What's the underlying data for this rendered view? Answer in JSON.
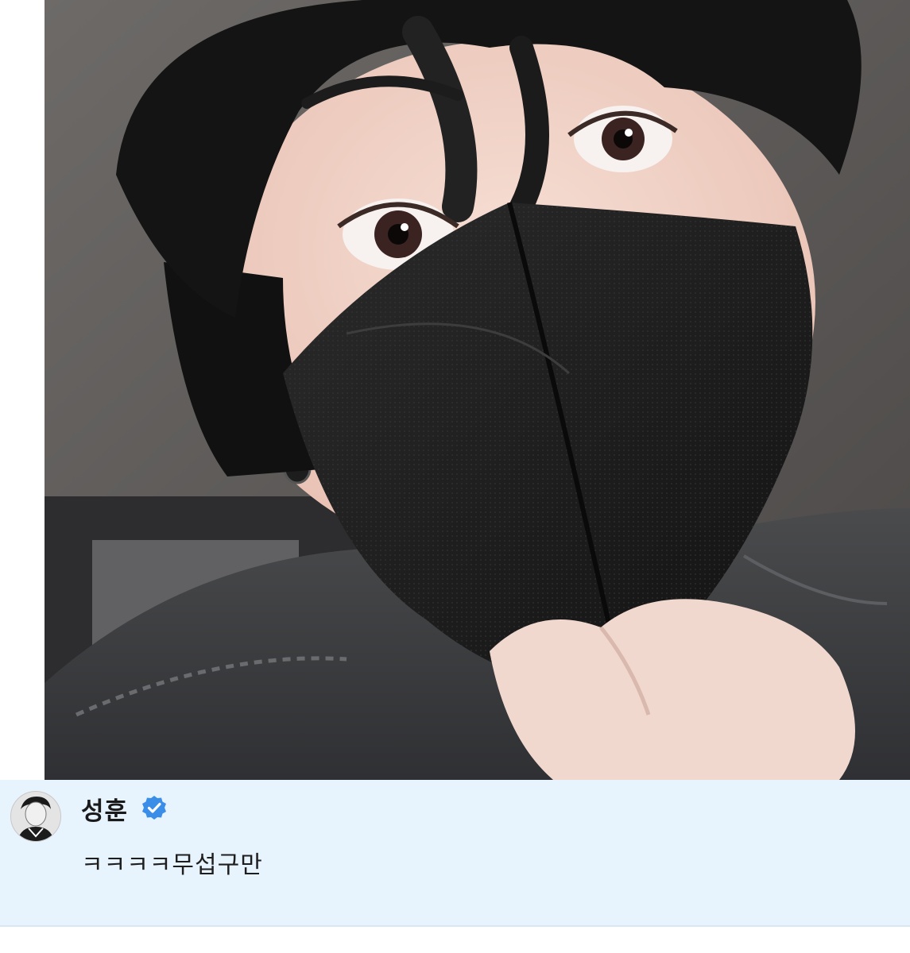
{
  "comment": {
    "username": "성훈",
    "verified": true,
    "text": "ㅋㅋㅋㅋ무섭구만"
  },
  "photo": {
    "subject": "selfie-person-black-mask"
  },
  "icons": {
    "verified": "verified-badge-icon",
    "avatar": "avatar"
  },
  "colors": {
    "card_background": "#e7f3fd",
    "verified_blue": "#3b8ee8",
    "text": "#1e1e1e"
  }
}
